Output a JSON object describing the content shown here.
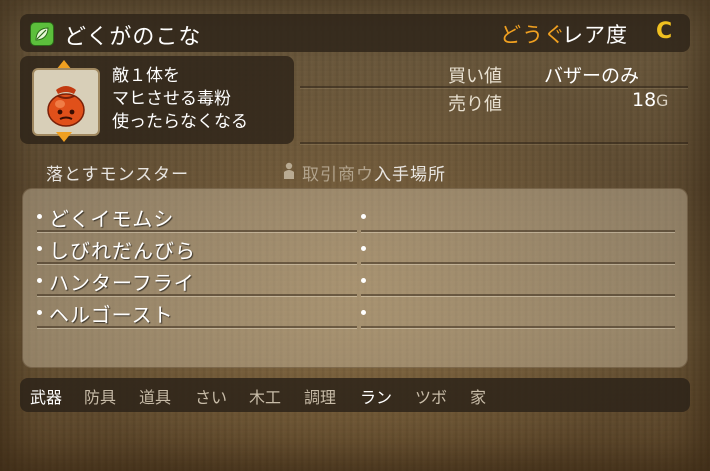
{
  "item": {
    "name": "どくがのこな",
    "icon": "leaf-icon",
    "category": "どうぐ",
    "rarity_label": "レア度",
    "rarity_value": "C"
  },
  "description": {
    "lines": [
      "敵１体を",
      "マヒさせる毒粉",
      "使ったらなくなる"
    ],
    "icon": "poison-powder-bag-icon"
  },
  "price": {
    "buy_label": "買い値",
    "buy_value": "バザーのみ",
    "sell_label": "売り値",
    "sell_value": "18",
    "sell_unit": "G"
  },
  "tabs": {
    "drop_monsters": "落とすモンスター",
    "trade": "取引商ウ",
    "location": "入手場所"
  },
  "monsters": [
    {
      "name": "どくイモムシ"
    },
    {
      "name": "しびれだんびら"
    },
    {
      "name": "ハンターフライ"
    },
    {
      "name": "ヘルゴースト"
    }
  ],
  "craft_tabs": [
    {
      "label": "武器",
      "active": true
    },
    {
      "label": "防具",
      "active": false
    },
    {
      "label": "道具",
      "active": false
    },
    {
      "label": "さい",
      "active": false
    },
    {
      "label": "木工",
      "active": false
    },
    {
      "label": "調理",
      "active": false
    },
    {
      "label": "ラン",
      "active": true
    },
    {
      "label": "ツボ",
      "active": false
    },
    {
      "label": "家",
      "active": false
    }
  ],
  "colors": {
    "accent": "#f0a020",
    "rarity": "#f0c020",
    "active_tab": "#ffffff",
    "inactive_tab": "#c8bca8"
  }
}
